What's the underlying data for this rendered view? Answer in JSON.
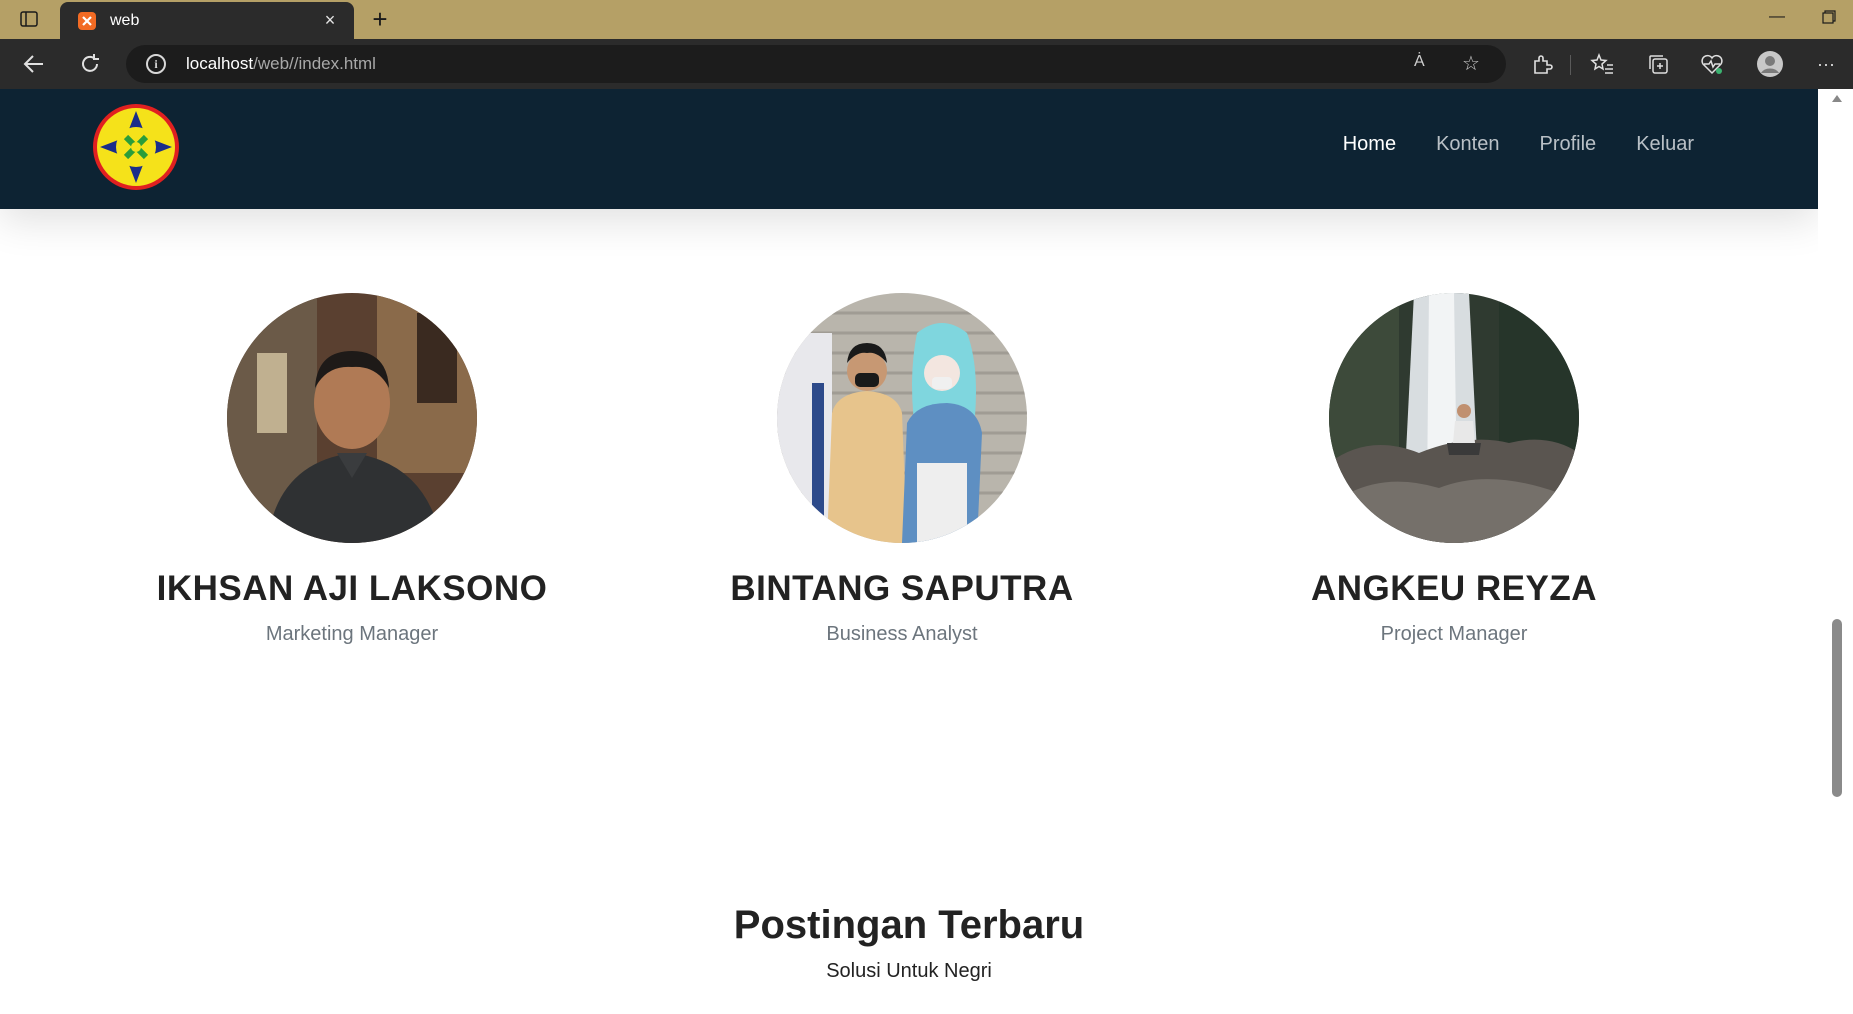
{
  "browser": {
    "tab_title": "web",
    "url_host": "localhost",
    "url_path": "/web//index.html",
    "new_tab_label": "+",
    "close_tab_label": "×",
    "minimize_label": "—",
    "read_aloud_label": "Ȧ",
    "favorite_label": "☆",
    "more_label": "···"
  },
  "navbar": {
    "items": [
      {
        "label": "Home",
        "active": true
      },
      {
        "label": "Konten",
        "active": false
      },
      {
        "label": "Profile",
        "active": false
      },
      {
        "label": "Keluar",
        "active": false
      }
    ]
  },
  "team": [
    {
      "name": "IKHSAN AJI LAKSONO",
      "role": "Marketing Manager"
    },
    {
      "name": "BINTANG SAPUTRA",
      "role": "Business Analyst"
    },
    {
      "name": "ANGKEU REYZA",
      "role": "Project Manager"
    }
  ],
  "posts": {
    "title": "Postingan Terbaru",
    "subtitle": "Solusi Untuk Negri"
  },
  "colors": {
    "tabbar": "#b5a066",
    "chrome_dark": "#2b2b2b",
    "navbar": "#0d2333",
    "nav_active": "#ffffff",
    "nav_inactive": "#b9c0c6",
    "role_text": "#6c757d"
  }
}
